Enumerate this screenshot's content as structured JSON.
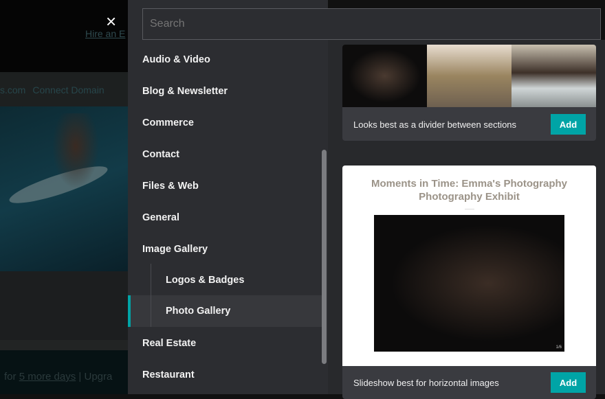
{
  "background": {
    "hire_link": "Hire an E",
    "nav": [
      "s.com",
      "Connect Domain"
    ],
    "trial_prefix": "for",
    "trial_link": "5 more days",
    "trial_sep": "|",
    "upgrade": "Upgra"
  },
  "close_icon": "×",
  "search": {
    "placeholder": "Search"
  },
  "sidebar": {
    "items": [
      {
        "label": "Audio & Video"
      },
      {
        "label": "Blog & Newsletter"
      },
      {
        "label": "Commerce"
      },
      {
        "label": "Contact"
      },
      {
        "label": "Files & Web"
      },
      {
        "label": "General"
      },
      {
        "label": "Image Gallery"
      },
      {
        "label": "Logos & Badges"
      },
      {
        "label": "Photo Gallery"
      },
      {
        "label": "Real Estate"
      },
      {
        "label": "Restaurant"
      }
    ],
    "active": "Photo Gallery"
  },
  "cards": [
    {
      "description": "Looks best as a divider between sections",
      "add_label": "Add"
    },
    {
      "preview_title": "Moments in Time: Emma's Photography Photography Exhibit",
      "counter": "1/6",
      "description": "Slideshow best for horizontal images",
      "add_label": "Add"
    }
  ],
  "colors": {
    "accent": "#00a4a6",
    "sidebar": "#2c2d31",
    "panel": "#28292c"
  }
}
